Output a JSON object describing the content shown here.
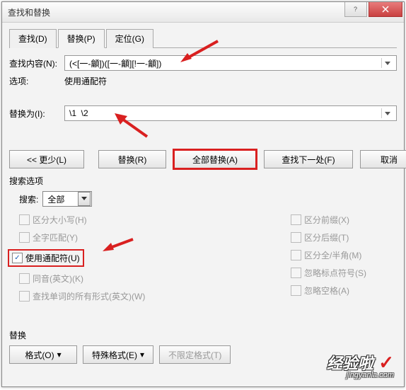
{
  "window": {
    "title": "查找和替换"
  },
  "tabs": {
    "find": "查找(D)",
    "replace": "替换(P)",
    "goto": "定位(G)"
  },
  "form": {
    "find_label": "查找内容(N):",
    "find_value": "(<[一-龥])([一-龥][!一-龥])",
    "options_label": "选项:",
    "options_value": "使用通配符",
    "replace_label": "替换为(I):",
    "replace_value": "\\1  \\2"
  },
  "buttons": {
    "less": "<< 更少(L)",
    "replace": "替换(R)",
    "replace_all": "全部替换(A)",
    "find_next": "查找下一处(F)",
    "cancel": "取消"
  },
  "search_options": {
    "title": "搜索选项",
    "search_label": "搜索:",
    "search_value": "全部",
    "match_case": "区分大小写(H)",
    "whole_word": "全字匹配(Y)",
    "wildcards": "使用通配符(U)",
    "sounds_like": "同音(英文)(K)",
    "word_forms": "查找单词的所有形式(英文)(W)",
    "match_prefix": "区分前缀(X)",
    "match_suffix": "区分后缀(T)",
    "full_half": "区分全/半角(M)",
    "ignore_punct": "忽略标点符号(S)",
    "ignore_space": "忽略空格(A)"
  },
  "bottom": {
    "title": "替换",
    "format": "格式(O)",
    "special": "特殊格式(E)",
    "no_format": "不限定格式(T)"
  },
  "watermark": {
    "main": "经验啦",
    "sub": "jingyanla.com"
  }
}
